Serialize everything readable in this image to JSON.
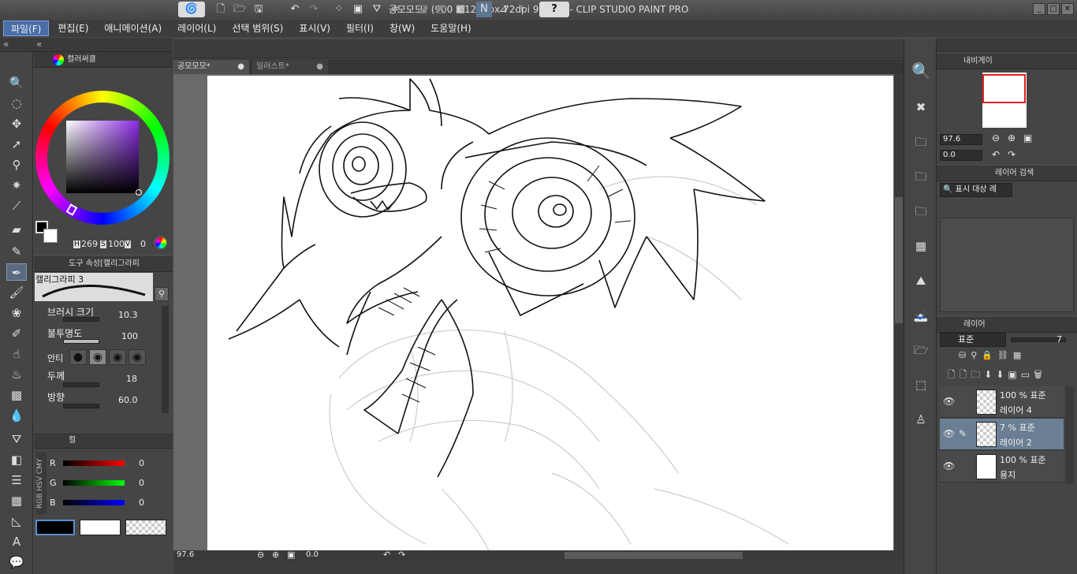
{
  "window": {
    "title": "공모모모* (900 x 1200px 72dpi 97.6%)  - CLIP STUDIO PAINT PRO"
  },
  "menu": [
    "파일(F)",
    "편집(E)",
    "애니메이션(A)",
    "레이어(L)",
    "선택 범위(S)",
    "표시(V)",
    "필터(I)",
    "창(W)",
    "도움말(H)"
  ],
  "color_panel": {
    "tab": "컬러써클",
    "h_label": "H",
    "h_value": "269",
    "s_label": "S",
    "s_value": "100",
    "v_label": "V",
    "v_value": "0"
  },
  "tool_props": {
    "tab": "도구 속성[캘리그라피",
    "brush_name": "캘리그라피 3",
    "size_label": "브러시 크기",
    "size_value": "10.3",
    "opacity_label": "불투명도",
    "opacity_value": "100",
    "anti_label": "안티",
    "thickness_label": "두께",
    "thickness_value": "18",
    "direction_label": "방향",
    "direction_value": "60.0"
  },
  "color_slider": {
    "tab": "컬",
    "side_labels": [
      "RGB",
      "HSV",
      "CMY"
    ],
    "r_label": "R",
    "r_value": "0",
    "g_label": "G",
    "g_value": "0",
    "b_label": "B",
    "b_value": "0"
  },
  "canvas": {
    "tabs": [
      "공모모모*",
      "일러스트*"
    ],
    "zoom": "97.6",
    "angle": "0.0"
  },
  "navigator": {
    "tab": "내비게이",
    "zoom": "97.6",
    "angle": "0.0"
  },
  "layer_search": {
    "tab": "레이어 검색",
    "filter": "표시 대상 레"
  },
  "layers_panel": {
    "tab": "레이어",
    "blend": "표준",
    "opacity": "7"
  },
  "layers": [
    {
      "info": "100 % 표준",
      "name": "레이어 4",
      "selected": false,
      "type": "transparent"
    },
    {
      "info": "7 % 표준",
      "name": "레이어 2",
      "selected": true,
      "type": "transparent"
    },
    {
      "info": "100 % 표준",
      "name": "용지",
      "selected": false,
      "type": "paper"
    }
  ],
  "colors": {
    "accent": "#4a6ea8",
    "selected_layer": "#6a7f94",
    "main_color": "#000000",
    "sub_color": "#ffffff"
  }
}
